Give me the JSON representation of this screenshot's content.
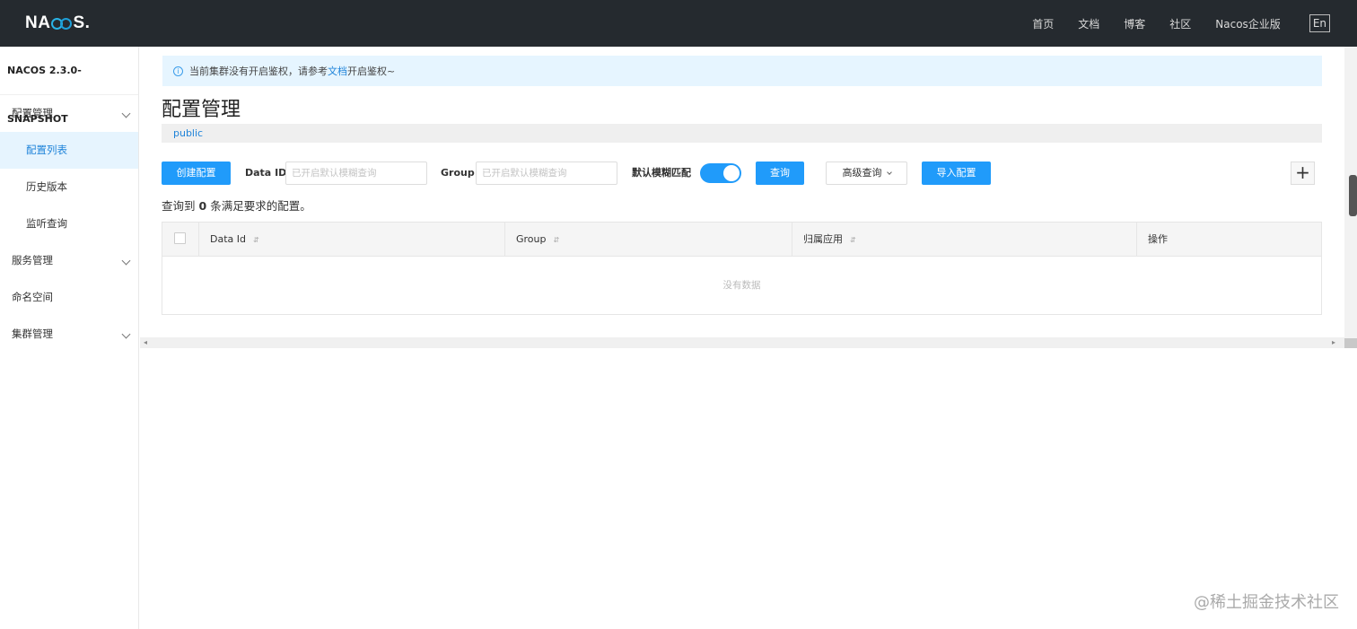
{
  "header": {
    "logo_text": "NACOS.",
    "nav": [
      "首页",
      "文档",
      "博客",
      "社区",
      "Nacos企业版"
    ],
    "lang": "En"
  },
  "sidebar": {
    "version": "NACOS 2.3.0-SNAPSHOT",
    "items": [
      {
        "label": "配置管理",
        "expandable": true
      },
      {
        "label": "配置列表",
        "sub": true,
        "active": true
      },
      {
        "label": "历史版本",
        "sub": true
      },
      {
        "label": "监听查询",
        "sub": true
      },
      {
        "label": "服务管理",
        "expandable": true
      },
      {
        "label": "命名空间"
      },
      {
        "label": "集群管理",
        "expandable": true
      }
    ]
  },
  "notice": {
    "prefix": "当前集群没有开启鉴权，请参考",
    "link": "文档",
    "suffix": "开启鉴权~"
  },
  "page": {
    "title": "配置管理",
    "namespace": "public"
  },
  "filter": {
    "create_button": "创建配置",
    "data_id_label": "Data ID",
    "data_id_placeholder": "已开启默认模糊查询",
    "group_label": "Group",
    "group_placeholder": "已开启默认模糊查询",
    "fuzzy_label": "默认模糊匹配",
    "fuzzy_enabled": true,
    "query_button": "查询",
    "advanced_button": "高级查询",
    "import_button": "导入配置",
    "plus": "+"
  },
  "result": {
    "prefix": "查询到",
    "count": "0",
    "suffix": "条满足要求的配置。"
  },
  "table": {
    "columns": [
      "Data Id",
      "Group",
      "归属应用",
      "操作"
    ],
    "empty_text": "没有数据"
  },
  "watermark": "@稀土掘金技术社区",
  "colors": {
    "header_bg": "#252a2f",
    "primary": "#209bfa",
    "active_bg": "#e6f4fe",
    "notice_bg": "#e6f5ff"
  }
}
